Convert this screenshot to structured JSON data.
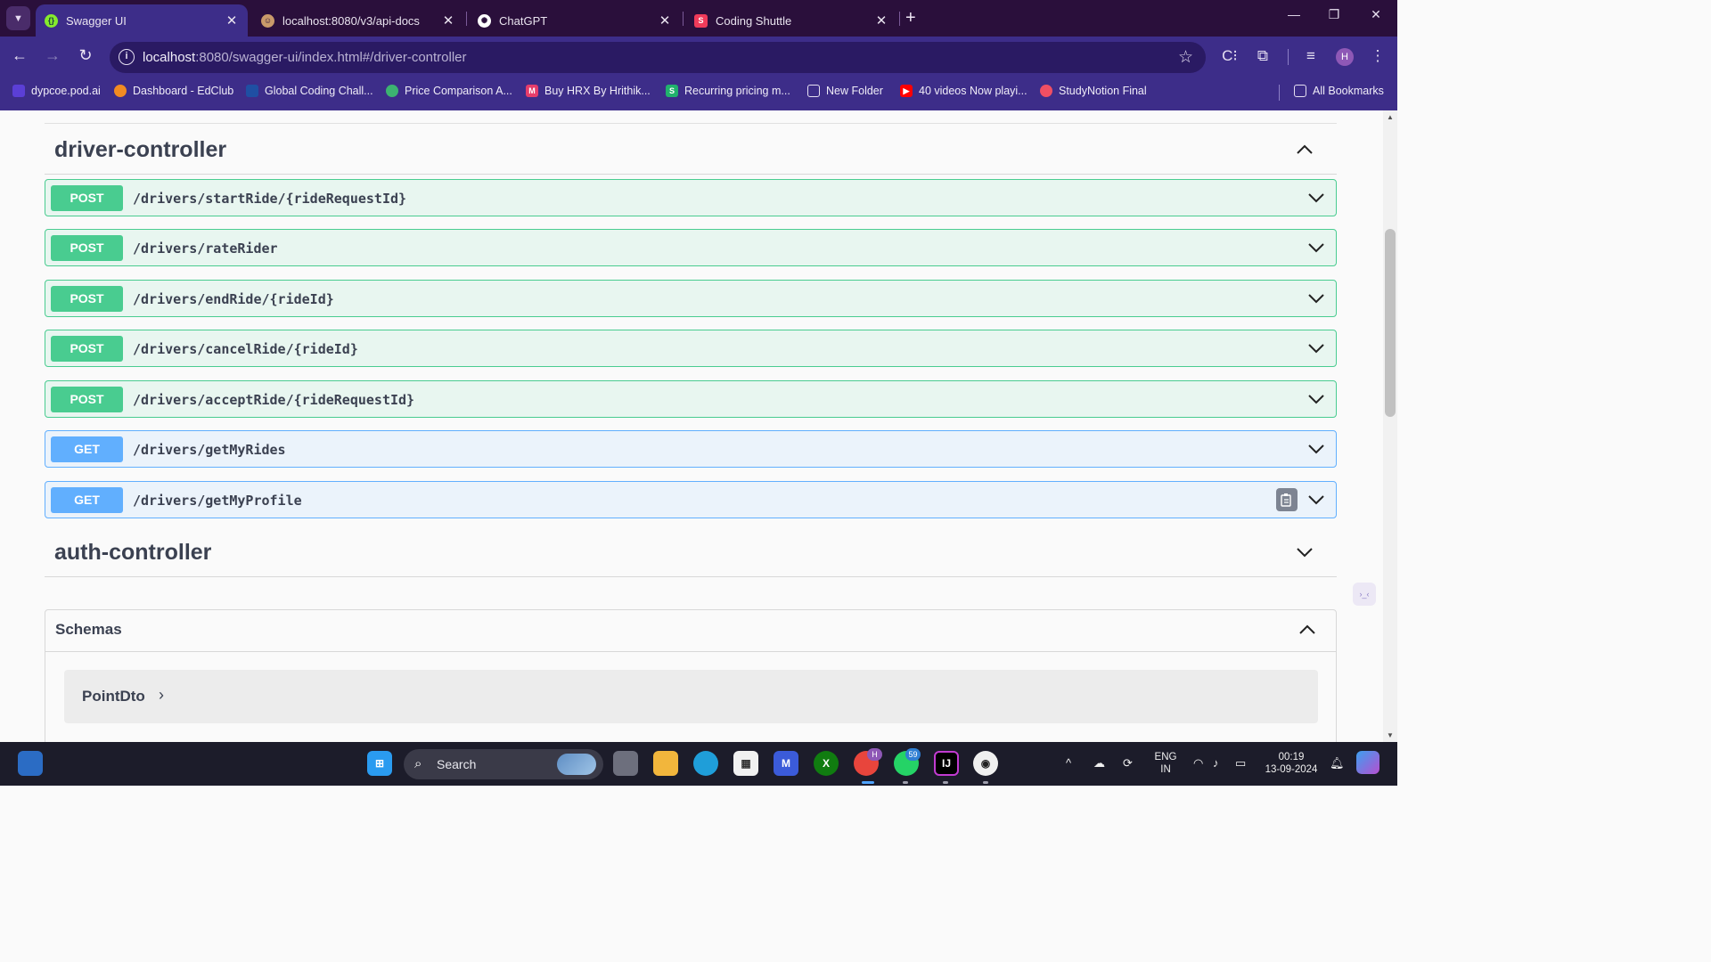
{
  "browser": {
    "tabs": [
      {
        "title": "Swagger UI",
        "active": true,
        "favicon_color": "#85ea2d"
      },
      {
        "title": "localhost:8080/v3/api-docs",
        "active": false,
        "favicon_color": "#c99a6a"
      },
      {
        "title": "ChatGPT",
        "active": false,
        "favicon_color": "#ffffff"
      },
      {
        "title": "Coding Shuttle",
        "active": false,
        "favicon_color": "#ef3b5a"
      }
    ],
    "address": {
      "host": "localhost",
      "rest": ":8080/swagger-ui/index.html#/driver-controller"
    },
    "profile_initial": "H",
    "bookmarks": [
      {
        "label": "dypcoe.pod.ai",
        "icon_color": "#5b3fd6"
      },
      {
        "label": "Dashboard - EdClub",
        "icon_color": "#f28b22"
      },
      {
        "label": "Global Coding Chall...",
        "icon_color": "#1f4fa3"
      },
      {
        "label": "Price Comparison A...",
        "icon_color": "#3cb371"
      },
      {
        "label": "Buy HRX By Hrithik...",
        "icon_color": "#e63d6b"
      },
      {
        "label": "Recurring pricing m...",
        "icon_color": "#21b26d"
      },
      {
        "label": "New Folder",
        "icon_color": "#3d2d89"
      },
      {
        "label": "40 videos Now playi...",
        "icon_color": "#ff0000"
      },
      {
        "label": "StudyNotion Final",
        "icon_color": "#f04f63"
      }
    ],
    "all_bookmarks": "All Bookmarks"
  },
  "swagger": {
    "driver_controller": {
      "name": "driver-controller",
      "operations": [
        {
          "method": "POST",
          "path": "/drivers/startRide/{rideRequestId}"
        },
        {
          "method": "POST",
          "path": "/drivers/rateRider"
        },
        {
          "method": "POST",
          "path": "/drivers/endRide/{rideId}"
        },
        {
          "method": "POST",
          "path": "/drivers/cancelRide/{rideId}"
        },
        {
          "method": "POST",
          "path": "/drivers/acceptRide/{rideRequestId}"
        },
        {
          "method": "GET",
          "path": "/drivers/getMyRides"
        },
        {
          "method": "GET",
          "path": "/drivers/getMyProfile"
        }
      ]
    },
    "auth_controller": {
      "name": "auth-controller"
    },
    "schemas": {
      "label": "Schemas",
      "models": [
        "PointDto"
      ]
    }
  },
  "taskbar": {
    "search_label": "Search",
    "whatsapp_badge": "59",
    "chrome_badge": "H",
    "lang_line1": "ENG",
    "lang_line2": "IN",
    "time": "00:19",
    "date": "13-09-2024"
  },
  "colors": {
    "post": "#49cc90",
    "get": "#61affe",
    "chrome_dark": "#2a0f3b",
    "chrome_accent": "#3d2d89"
  }
}
